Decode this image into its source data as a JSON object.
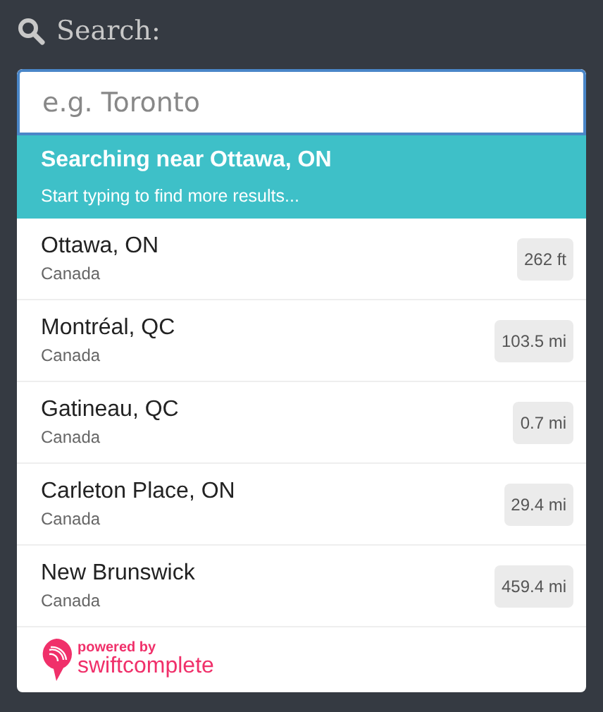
{
  "heading": "Search:",
  "search": {
    "placeholder": "e.g. Toronto"
  },
  "banner": {
    "title": "Searching near Ottawa, ON",
    "subtitle": "Start typing to find more results..."
  },
  "results": [
    {
      "name": "Ottawa, ON",
      "country": "Canada",
      "distance": "262 ft"
    },
    {
      "name": "Montréal, QC",
      "country": "Canada",
      "distance": "103.5 mi"
    },
    {
      "name": "Gatineau, QC",
      "country": "Canada",
      "distance": "0.7 mi"
    },
    {
      "name": "Carleton Place, ON",
      "country": "Canada",
      "distance": "29.4 mi"
    },
    {
      "name": "New Brunswick",
      "country": "Canada",
      "distance": "459.4 mi"
    }
  ],
  "footer": {
    "powered": "powered by",
    "brand": "swiftcomplete"
  }
}
